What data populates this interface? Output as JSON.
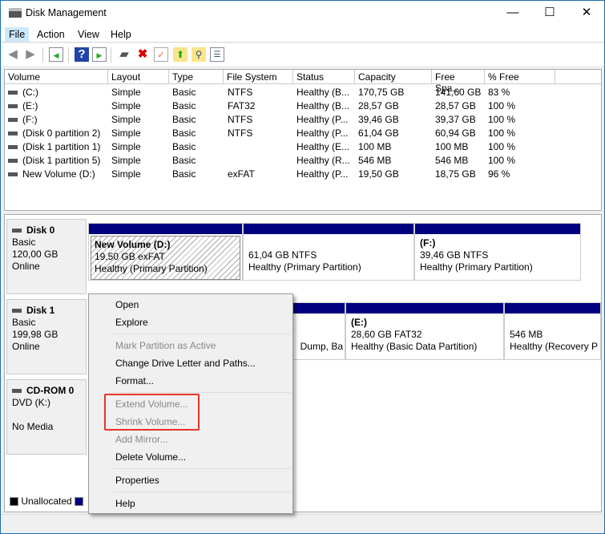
{
  "window": {
    "title": "Disk Management",
    "icon": "disk-management-icon"
  },
  "menubar": [
    "File",
    "Action",
    "View",
    "Help"
  ],
  "toolbar": [
    "back-icon",
    "forward-icon",
    "console-tree-icon",
    "help-icon",
    "show-pane-icon",
    "connect-disk-icon",
    "delete-icon",
    "check-icon",
    "folder-up-icon",
    "folder-search-icon",
    "properties-list-icon"
  ],
  "table": {
    "columns": [
      "Volume",
      "Layout",
      "Type",
      "File System",
      "Status",
      "Capacity",
      "Free Spa...",
      "% Free"
    ],
    "rows": [
      [
        "(C:)",
        "Simple",
        "Basic",
        "NTFS",
        "Healthy (B...",
        "170,75 GB",
        "141,60 GB",
        "83 %"
      ],
      [
        "(E:)",
        "Simple",
        "Basic",
        "FAT32",
        "Healthy (B...",
        "28,57 GB",
        "28,57 GB",
        "100 %"
      ],
      [
        "(F:)",
        "Simple",
        "Basic",
        "NTFS",
        "Healthy (P...",
        "39,46 GB",
        "39,37 GB",
        "100 %"
      ],
      [
        "(Disk 0 partition 2)",
        "Simple",
        "Basic",
        "NTFS",
        "Healthy (P...",
        "61,04 GB",
        "60,94 GB",
        "100 %"
      ],
      [
        "(Disk 1 partition 1)",
        "Simple",
        "Basic",
        "",
        "Healthy (E...",
        "100 MB",
        "100 MB",
        "100 %"
      ],
      [
        "(Disk 1 partition 5)",
        "Simple",
        "Basic",
        "",
        "Healthy (R...",
        "546 MB",
        "546 MB",
        "100 %"
      ],
      [
        "New Volume (D:)",
        "Simple",
        "Basic",
        "exFAT",
        "Healthy (P...",
        "19,50 GB",
        "18,75 GB",
        "96 %"
      ]
    ]
  },
  "disks": [
    {
      "name": "Disk 0",
      "type": "Basic",
      "size": "120,00 GB",
      "state": "Online",
      "partitions": [
        [
          "New Volume  (D:)",
          "19,50 GB exFAT",
          "Healthy (Primary Partition)"
        ],
        [
          "",
          "61,04 GB NTFS",
          "Healthy (Primary Partition)"
        ],
        [
          "(F:)",
          "39,46 GB NTFS",
          "Healthy (Primary Partition)"
        ]
      ]
    },
    {
      "name": "Disk 1",
      "type": "Basic",
      "size": "199,98 GB",
      "state": "Online",
      "partitions": [
        [
          "",
          "",
          "Dump, Ba"
        ],
        [
          "(E:)",
          "28,60 GB FAT32",
          "Healthy (Basic Data Partition)"
        ],
        [
          "",
          "546 MB",
          "Healthy (Recovery P"
        ]
      ]
    },
    {
      "name": "CD-ROM 0",
      "type": "DVD (K:)",
      "size": "",
      "state": "No Media"
    }
  ],
  "legend": [
    "Unallocated"
  ],
  "context_menu": [
    {
      "label": "Open",
      "enabled": true
    },
    {
      "label": "Explore",
      "enabled": true
    },
    {
      "label": "Mark Partition as Active",
      "enabled": false
    },
    {
      "label": "Change Drive Letter and Paths...",
      "enabled": true
    },
    {
      "label": "Format...",
      "enabled": true
    },
    {
      "label": "Extend Volume...",
      "enabled": false
    },
    {
      "label": "Shrink Volume...",
      "enabled": false
    },
    {
      "label": "Add Mirror...",
      "enabled": false
    },
    {
      "label": "Delete Volume...",
      "enabled": true
    },
    {
      "label": "Properties",
      "enabled": true
    },
    {
      "label": "Help",
      "enabled": true
    }
  ],
  "colors": {
    "primary": "#000080",
    "unallocated": "#000000",
    "highlight": "#e8332a"
  }
}
